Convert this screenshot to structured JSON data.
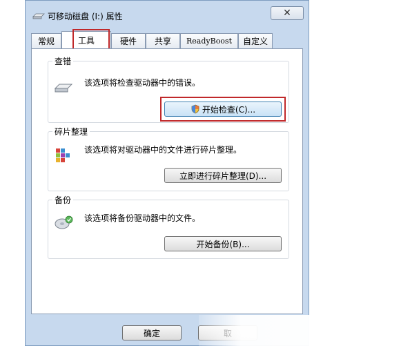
{
  "window": {
    "title": "可移动磁盘 (I:) 属性",
    "close_label": "✕"
  },
  "tabs": [
    {
      "label": "常规"
    },
    {
      "label": "工具"
    },
    {
      "label": "硬件"
    },
    {
      "label": "共享"
    },
    {
      "label": "ReadyBoost"
    },
    {
      "label": "自定义"
    }
  ],
  "groups": {
    "error_check": {
      "title": "查错",
      "description": "该选项将检查驱动器中的错误。",
      "button_label": "开始检查(C)..."
    },
    "defrag": {
      "title": "碎片整理",
      "description": "该选项将对驱动器中的文件进行碎片整理。",
      "button_label": "立即进行碎片整理(D)..."
    },
    "backup": {
      "title": "备份",
      "description": "该选项将备份驱动器中的文件。",
      "button_label": "开始备份(B)..."
    }
  },
  "footer": {
    "ok_label": "确定",
    "cancel_label": "取"
  },
  "colors": {
    "highlight": "#c0282a",
    "frame": "#c7d9ee"
  }
}
